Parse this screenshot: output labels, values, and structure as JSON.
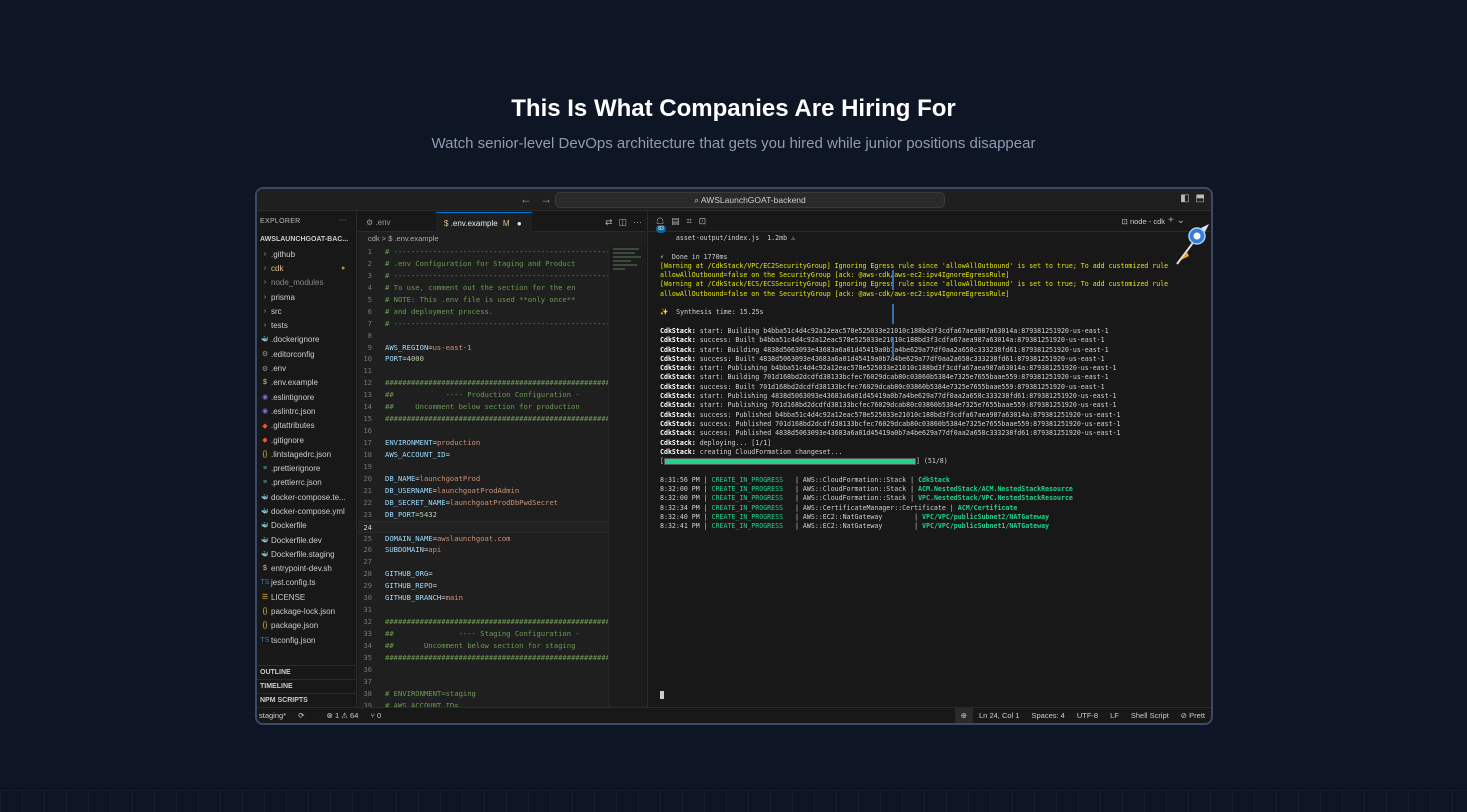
{
  "hero": {
    "title": "This Is What Companies Are Hiring For",
    "subtitle": "Watch senior-level DevOps architecture that gets you hired while junior positions disappear"
  },
  "window": {
    "search_text": "AWSLaunchGOAT-backend"
  },
  "explorer": {
    "header": "EXPLORER",
    "project": "AWSLAUNCHGOAT-BAC...",
    "items": [
      {
        "label": ".github",
        "icon": "chevron-right"
      },
      {
        "label": "cdk",
        "icon": "chevron-right",
        "modified": true
      },
      {
        "label": "node_modules",
        "icon": "chevron-right",
        "muted": true
      },
      {
        "label": "prisma",
        "icon": "chevron-right"
      },
      {
        "label": "src",
        "icon": "chevron-right"
      },
      {
        "label": "tests",
        "icon": "chevron-right"
      },
      {
        "label": ".dockerignore",
        "icon": "docker"
      },
      {
        "label": ".editorconfig",
        "icon": "gear"
      },
      {
        "label": ".env",
        "icon": "gear"
      },
      {
        "label": ".env.example",
        "icon": "dollar"
      },
      {
        "label": ".eslintignore",
        "icon": "eslint"
      },
      {
        "label": ".eslintrc.json",
        "icon": "eslint"
      },
      {
        "label": ".gitattributes",
        "icon": "git"
      },
      {
        "label": ".gitignore",
        "icon": "git"
      },
      {
        "label": ".lintstagedrc.json",
        "icon": "braces"
      },
      {
        "label": ".prettierignore",
        "icon": "prettier"
      },
      {
        "label": ".prettierrc.json",
        "icon": "prettier"
      },
      {
        "label": "docker-compose.te...",
        "icon": "docker"
      },
      {
        "label": "docker-compose.yml",
        "icon": "docker"
      },
      {
        "label": "Dockerfile",
        "icon": "docker"
      },
      {
        "label": "Dockerfile.dev",
        "icon": "docker"
      },
      {
        "label": "Dockerfile.staging",
        "icon": "docker"
      },
      {
        "label": "entrypoint-dev.sh",
        "icon": "dollar"
      },
      {
        "label": "jest.config.ts",
        "icon": "ts"
      },
      {
        "label": "LICENSE",
        "icon": "license"
      },
      {
        "label": "package-lock.json",
        "icon": "braces"
      },
      {
        "label": "package.json",
        "icon": "braces"
      },
      {
        "label": "tsconfig.json",
        "icon": "ts"
      }
    ],
    "sections": [
      "OUTLINE",
      "TIMELINE",
      "NPM SCRIPTS"
    ]
  },
  "editor": {
    "tabs": [
      {
        "label": ".env",
        "active": false
      },
      {
        "label": ".env.example",
        "active": true,
        "badge": "M"
      }
    ],
    "breadcrumb": "cdk  >  $  .env.example",
    "current_line": 24,
    "lines": [
      {
        "n": 1,
        "parts": [
          [
            "c",
            "# -----------------------------------------------------------"
          ]
        ]
      },
      {
        "n": 2,
        "parts": [
          [
            "c",
            "# .env Configuration for Staging and Product"
          ]
        ]
      },
      {
        "n": 3,
        "parts": [
          [
            "c",
            "# -----------------------------------------------------------"
          ]
        ]
      },
      {
        "n": 4,
        "parts": [
          [
            "c",
            "# To use, comment out the section for the en"
          ]
        ]
      },
      {
        "n": 5,
        "parts": [
          [
            "c",
            "# NOTE: This .env file is used **only once**"
          ]
        ]
      },
      {
        "n": 6,
        "parts": [
          [
            "c",
            "# and deployment process."
          ]
        ]
      },
      {
        "n": 7,
        "parts": [
          [
            "c",
            "# -----------------------------------------------------------"
          ]
        ]
      },
      {
        "n": 8,
        "parts": []
      },
      {
        "n": 9,
        "parts": [
          [
            "k",
            "AWS_REGION"
          ],
          [
            "t",
            "="
          ],
          [
            "v",
            "us-east-1"
          ]
        ]
      },
      {
        "n": 10,
        "parts": [
          [
            "k",
            "PORT"
          ],
          [
            "t",
            "="
          ],
          [
            "n",
            "4000"
          ]
        ]
      },
      {
        "n": 11,
        "parts": []
      },
      {
        "n": 12,
        "parts": [
          [
            "c",
            "##########################################################"
          ]
        ]
      },
      {
        "n": 13,
        "parts": [
          [
            "c",
            "##            ---- Production Configuration -"
          ]
        ]
      },
      {
        "n": 14,
        "parts": [
          [
            "c",
            "##     Uncomment below section for production"
          ]
        ]
      },
      {
        "n": 15,
        "parts": [
          [
            "c",
            "##########################################################"
          ]
        ]
      },
      {
        "n": 16,
        "parts": []
      },
      {
        "n": 17,
        "parts": [
          [
            "k",
            "ENVIRONMENT"
          ],
          [
            "t",
            "="
          ],
          [
            "v",
            "production"
          ]
        ]
      },
      {
        "n": 18,
        "parts": [
          [
            "k",
            "AWS_ACCOUNT_ID"
          ],
          [
            "t",
            "="
          ]
        ]
      },
      {
        "n": 19,
        "parts": []
      },
      {
        "n": 20,
        "parts": [
          [
            "k",
            "DB_NAME"
          ],
          [
            "t",
            "="
          ],
          [
            "v",
            "launchgoatProd"
          ]
        ]
      },
      {
        "n": 21,
        "parts": [
          [
            "k",
            "DB_USERNAME"
          ],
          [
            "t",
            "="
          ],
          [
            "v",
            "launchgoatProdAdmin"
          ]
        ]
      },
      {
        "n": 22,
        "parts": [
          [
            "k",
            "DB_SECRET_NAME"
          ],
          [
            "t",
            "="
          ],
          [
            "v",
            "launchgoatProdDbPwdSecret"
          ]
        ]
      },
      {
        "n": 23,
        "parts": [
          [
            "k",
            "DB_PORT"
          ],
          [
            "t",
            "="
          ],
          [
            "n",
            "5432"
          ]
        ]
      },
      {
        "n": 24,
        "parts": []
      },
      {
        "n": 25,
        "parts": [
          [
            "k",
            "DOMAIN_NAME"
          ],
          [
            "t",
            "="
          ],
          [
            "v",
            "awslaunchgoat.com"
          ]
        ]
      },
      {
        "n": 26,
        "parts": [
          [
            "k",
            "SUBDOMAIN"
          ],
          [
            "t",
            "="
          ],
          [
            "v",
            "api"
          ]
        ]
      },
      {
        "n": 27,
        "parts": []
      },
      {
        "n": 28,
        "parts": [
          [
            "k",
            "GITHUB_ORG"
          ],
          [
            "t",
            "="
          ]
        ]
      },
      {
        "n": 29,
        "parts": [
          [
            "k",
            "GITHUB_REPO"
          ],
          [
            "t",
            "="
          ]
        ]
      },
      {
        "n": 30,
        "parts": [
          [
            "k",
            "GITHUB_BRANCH"
          ],
          [
            "t",
            "="
          ],
          [
            "v",
            "main"
          ]
        ]
      },
      {
        "n": 31,
        "parts": []
      },
      {
        "n": 32,
        "parts": [
          [
            "c",
            "##########################################################"
          ]
        ]
      },
      {
        "n": 33,
        "parts": [
          [
            "c",
            "##               ---- Staging Configuration -"
          ]
        ]
      },
      {
        "n": 34,
        "parts": [
          [
            "c",
            "##       Uncomment below section for staging"
          ]
        ]
      },
      {
        "n": 35,
        "parts": [
          [
            "c",
            "##########################################################"
          ]
        ]
      },
      {
        "n": 36,
        "parts": []
      },
      {
        "n": 37,
        "parts": []
      },
      {
        "n": 38,
        "parts": [
          [
            "c",
            "# ENVIRONMENT=staging"
          ]
        ]
      },
      {
        "n": 39,
        "parts": [
          [
            "c",
            "# AWS_ACCOUNT_ID="
          ]
        ]
      },
      {
        "n": 40,
        "parts": []
      }
    ]
  },
  "terminal": {
    "tab_name": "node - cdk",
    "badge": "83",
    "progress": {
      "fraction": 1.0,
      "label": "(51/8)"
    },
    "lines": [
      {
        "type": "plain",
        "text": "    asset-output/index.js  1.2mb ⚠"
      },
      {
        "type": "blank"
      },
      {
        "type": "plain",
        "text": "⚡  Done in 1770ms"
      },
      {
        "type": "warn",
        "text": "[Warning at /CdkStack/VPC/EC2SecurityGroup] Ignoring Egress rule since 'allowAllOutbound' is set to true; To add customized rule"
      },
      {
        "type": "warn",
        "text": "allowAllOutbound=false on the SecurityGroup [ack: @aws-cdk/aws-ec2:ipv4IgnoreEgressRule]"
      },
      {
        "type": "warn",
        "text": "[Warning at /CdkStack/ECS/ECSSecurityGroup] Ignoring Egress rule since 'allowAllOutbound' is set to true; To add customized rule"
      },
      {
        "type": "warn",
        "text": "allowAllOutbound=false on the SecurityGroup [ack: @aws-cdk/aws-ec2:ipv4IgnoreEgressRule]"
      },
      {
        "type": "blank"
      },
      {
        "type": "plain",
        "text": "✨  Synthesis time: 15.25s"
      },
      {
        "type": "blank"
      },
      {
        "type": "stack",
        "text": "start: Building b4bba51c4d4c92a12eac578e525033e21010c188bd3f3cdfa67aea987a63014a:879381251920-us-east-1"
      },
      {
        "type": "stack",
        "text": "success: Built b4bba51c4d4c92a12eac578e525033e21010c188bd3f3cdfa67aea987a63014a:879381251920-us-east-1"
      },
      {
        "type": "stack",
        "text": "start: Building 4838d5063093e43683a6a01d45419a0b7a4be629a77df0aa2a658c333238fd61:879381251920-us-east-1"
      },
      {
        "type": "stack",
        "text": "success: Built 4838d5063093e43683a6a01d45419a0b7a4be629a77df0aa2a658c333238fd61:879381251920-us-east-1"
      },
      {
        "type": "stack",
        "text": "start: Publishing b4bba51c4d4c92a12eac578e525033e21010c188bd3f3cdfa67aea987a63014a:879381251920-us-east-1"
      },
      {
        "type": "stack",
        "text": "start: Building 701d168bd2dcdfd38133bcfec76029dcab80c03860b5384e7325e7655baae559:879381251920-us-east-1"
      },
      {
        "type": "stack",
        "text": "success: Built 701d168bd2dcdfd38133bcfec76029dcab80c03860b5384e7325e7655baae559:879381251920-us-east-1"
      },
      {
        "type": "stack",
        "text": "start: Publishing 4838d5063093e43683a6a01d45419a0b7a4be629a77df0aa2a658c333238fd61:879381251920-us-east-1"
      },
      {
        "type": "stack",
        "text": "start: Publishing 701d168bd2dcdfd38133bcfec76029dcab80c03860b5384e7325e7655baae559:879381251920-us-east-1"
      },
      {
        "type": "stack",
        "text": "success: Published b4bba51c4d4c92a12eac578e525033e21010c188bd3f3cdfa67aea987a63014a:879381251920-us-east-1"
      },
      {
        "type": "stack",
        "text": "success: Published 701d168bd2dcdfd38133bcfec76029dcab80c03860b5384e7325e7655baae559:879381251920-us-east-1"
      },
      {
        "type": "stack",
        "text": "success: Published 4838d5063093e43683a6a01d45419a0b7a4be629a77df0aa2a658c333238fd61:879381251920-us-east-1"
      },
      {
        "type": "stack",
        "text": "deploying... [1/1]"
      },
      {
        "type": "stack",
        "text": "creating CloudFormation changeset..."
      },
      {
        "type": "progress"
      },
      {
        "type": "blank"
      },
      {
        "type": "event",
        "time": "8:31:56 PM",
        "status": "CREATE_IN_PROGRESS",
        "resource": "AWS::CloudFormation::Stack",
        "id": "CdkStack"
      },
      {
        "type": "event",
        "time": "8:32:00 PM",
        "status": "CREATE_IN_PROGRESS",
        "resource": "AWS::CloudFormation::Stack",
        "id": "ACM.NestedStack/ACM.NestedStackResource"
      },
      {
        "type": "event",
        "time": "8:32:00 PM",
        "status": "CREATE_IN_PROGRESS",
        "resource": "AWS::CloudFormation::Stack",
        "id": "VPC.NestedStack/VPC.NestedStackResource"
      },
      {
        "type": "event",
        "time": "8:32:34 PM",
        "status": "CREATE_IN_PROGRESS",
        "resource": "AWS::CertificateManager::Certificate",
        "id": "ACM/Certificate"
      },
      {
        "type": "event",
        "time": "8:32:40 PM",
        "status": "CREATE_IN_PROGRESS",
        "resource": "AWS::EC2::NatGateway       ",
        "id": "VPC/VPC/publicSubnet2/NATGateway"
      },
      {
        "type": "event",
        "time": "8:32:41 PM",
        "status": "CREATE_IN_PROGRESS",
        "resource": "AWS::EC2::NatGateway       ",
        "id": "VPC/VPC/publicSubnet1/NATGateway"
      }
    ]
  },
  "statusbar": {
    "branch": "staging*",
    "problems": "⊗ 1 ⚠ 64",
    "ports": "⑂ 0",
    "position": "Ln 24, Col 1",
    "spaces": "Spaces: 4",
    "encoding": "UTF-8",
    "eol": "LF",
    "language": "Shell Script",
    "prettier": "⊘ Prett"
  }
}
